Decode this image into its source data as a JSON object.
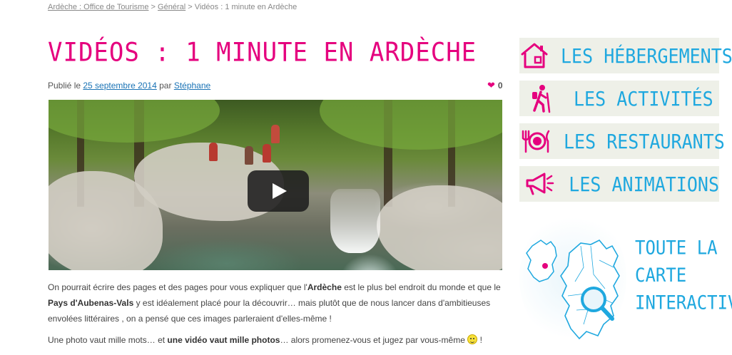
{
  "breadcrumb": {
    "home": "Ardèche : Office de Tourisme",
    "separator": ">",
    "category": "Général",
    "current": "Vidéos : 1 minute en Ardèche"
  },
  "post": {
    "title": "VIDÉOS : 1 MINUTE EN ARDÈCHE",
    "published_prefix": "Publié le",
    "date": "25 septembre 2014",
    "by": "par",
    "author": "Stéphane",
    "likes": "0"
  },
  "body": {
    "p1_a": "On pourrait écrire des pages et des pages pour vous expliquer que l'",
    "p1_b": "Ardèche",
    "p1_c": " est le plus bel endroit du monde et que le ",
    "p1_d": "Pays d'Aubenas-Vals",
    "p1_e": " y est idéalement placé pour la découvrir… mais plutôt que de nous lancer dans d'ambitieuses envolées littéraires , on a pensé que ces images parleraient d'elles-même !",
    "p2_a": "Une photo vaut mille mots… et ",
    "p2_b": "une vidéo vaut mille photos",
    "p2_c": "… alors promenez-vous et jugez par vous-même ",
    "p2_d": " !"
  },
  "sidebar": {
    "buttons": [
      {
        "label": "LES HÉBERGEMENTS",
        "icon": "house-icon"
      },
      {
        "label": "LES ACTIVITÉS",
        "icon": "hiker-icon"
      },
      {
        "label": "LES RESTAURANTS",
        "icon": "plate-icon"
      },
      {
        "label": "LES ANIMATIONS",
        "icon": "megaphone-icon"
      }
    ],
    "map_line1": "TOUTE LA",
    "map_line2": "CARTE",
    "map_line3": "INTERACTIVE"
  },
  "colors": {
    "accent_pink": "#e5007e",
    "accent_blue": "#1fa8df",
    "button_bg": "#eef0e8"
  }
}
